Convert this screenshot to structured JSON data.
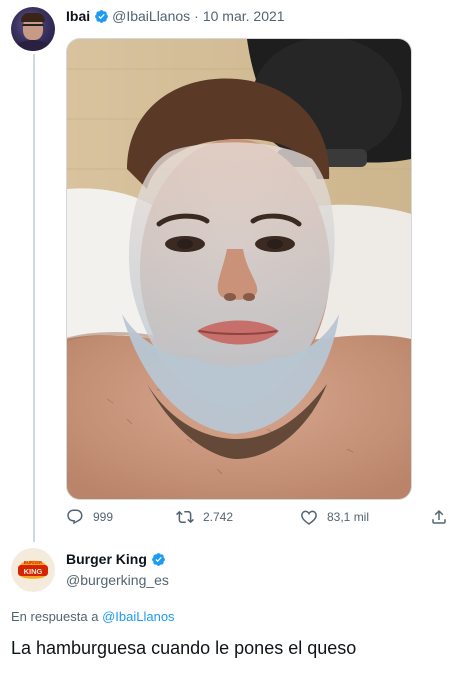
{
  "tweet": {
    "author_name": "Ibai",
    "author_handle": "@IbaiLlanos",
    "separator": "·",
    "date": "10 mar. 2021",
    "photo": {
      "description": "photo-with-face-mask"
    },
    "actions": {
      "replies": "999",
      "retweets": "2.742",
      "likes": "83,1 mil"
    }
  },
  "reply": {
    "author_name": "Burger King",
    "author_handle": "@burgerking_es",
    "in_reply_prefix": "En respuesta a",
    "in_reply_handle": "@IbaiLlanos",
    "text": "La hamburguesa cuando le pones el queso",
    "logo_text_top": "BURGER",
    "logo_text_bottom": "KING"
  },
  "colors": {
    "accent": "#1d9bf0",
    "muted_text": "#536471",
    "thread_line": "#cfd9de",
    "bk_red": "#d62300",
    "bk_bun": "#f5a623"
  }
}
